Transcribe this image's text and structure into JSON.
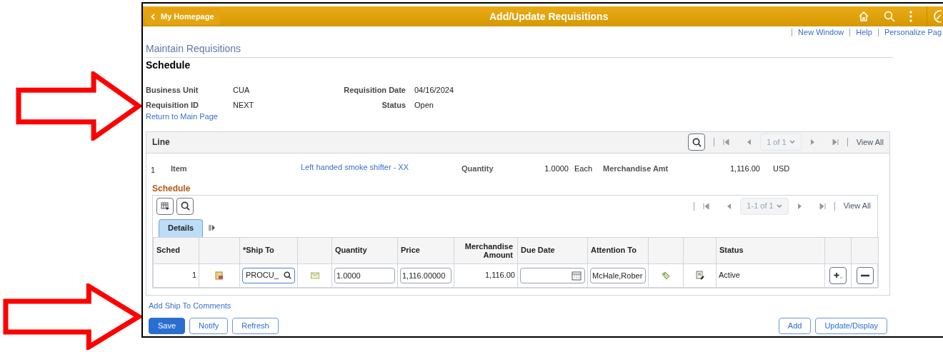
{
  "header": {
    "back": "My Homepage",
    "title": "Add/Update Requisitions"
  },
  "links": [
    "New Window",
    "Help",
    "Personalize Pag"
  ],
  "breadcrumb": "Maintain Requisitions",
  "page_title": "Schedule",
  "fields": [
    {
      "label": "Business Unit",
      "value": "CUA"
    },
    {
      "label": "Requisition Date",
      "value": "04/16/2024"
    },
    {
      "label": "Requisition ID",
      "value": "NEXT"
    },
    {
      "label": "Status",
      "value": "Open"
    }
  ],
  "return_link": "Return to Main Page",
  "line": {
    "title": "Line",
    "pager": "1 of 1",
    "view_all": "View All",
    "number": "1",
    "item_label": "Item",
    "item": "Left handed smoke shifter - XX",
    "quantity_label": "Quantity",
    "quantity": "1.0000",
    "unit": "Each",
    "amount_label": "Merchandise Amt",
    "amount": "1,116.00",
    "currency": "USD"
  },
  "schedule": {
    "title": "Schedule",
    "pager": "1-1 of 1",
    "view_all": "View All",
    "tabs": [
      {
        "label": "Details",
        "selected": true
      }
    ],
    "columns": [
      {
        "kind": "text",
        "label": "Sched"
      },
      {
        "kind": "text"
      },
      {
        "kind": "text",
        "label": "*Ship To"
      },
      {
        "kind": "text"
      },
      {
        "kind": "text",
        "label": "Quantity"
      },
      {
        "kind": "text",
        "label": "Price"
      },
      {
        "kind": "numeric",
        "label": "Merchandise Amount"
      },
      {
        "kind": "text",
        "label": "Due Date"
      },
      {
        "kind": "text",
        "label": "Attention To"
      },
      {
        "kind": "text"
      },
      {
        "kind": "text"
      },
      {
        "kind": "text",
        "label": "Status"
      },
      {
        "kind": "text"
      },
      {
        "kind": "text"
      }
    ],
    "rows": [
      {
        "cells": [
          {
            "kind": "number",
            "text": "1"
          },
          {
            "kind": "sheet"
          },
          {
            "kind": "lookup",
            "text": "PROCU_"
          },
          {
            "kind": "envelope"
          },
          {
            "kind": "input",
            "text": "1.0000"
          },
          {
            "kind": "input",
            "text": "1,116.00000"
          },
          {
            "kind": "number",
            "text": "1,116.00"
          },
          {
            "kind": "date"
          },
          {
            "kind": "input",
            "text": "McHale,Rober"
          },
          {
            "kind": "tag"
          },
          {
            "kind": "edit"
          },
          {
            "kind": "text",
            "text": "Active"
          },
          {
            "kind": "add"
          },
          {
            "kind": "remove"
          }
        ]
      }
    ]
  },
  "comments_link": "Add Ship To Comments",
  "buttons": [
    {
      "label": "Save",
      "primary": true
    },
    {
      "label": "Notify",
      "primary": false
    },
    {
      "label": "Refresh",
      "primary": false
    }
  ],
  "right_buttons": [
    {
      "label": "Add",
      "primary": false
    },
    {
      "label": "Update/Display",
      "primary": false
    }
  ]
}
